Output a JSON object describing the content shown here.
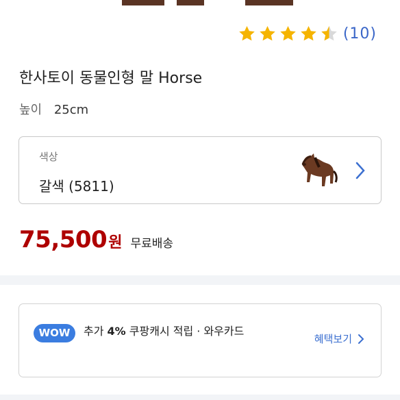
{
  "product": {
    "rating": {
      "stars": 4.5,
      "max": 5,
      "count_text": "(10)"
    },
    "title": "한사토이 동물인형 말 Horse",
    "spec": {
      "label": "높이",
      "value": "25cm"
    }
  },
  "option": {
    "label": "색상",
    "value": "갈색 (5811)",
    "thumbnail_icon": "horse-thumbnail",
    "chevron_icon": "chevron-right-icon"
  },
  "price": {
    "amount": "75,500",
    "unit": "원",
    "shipping": "무료배송",
    "color": "#ae0000"
  },
  "benefit": {
    "badge": "WOW",
    "text_pre": "추가 ",
    "percent": "4%",
    "text_post": " 쿠팡캐시 적립 · 와우카드",
    "link_label": "혜택보기",
    "accent": "#3b7de0"
  }
}
